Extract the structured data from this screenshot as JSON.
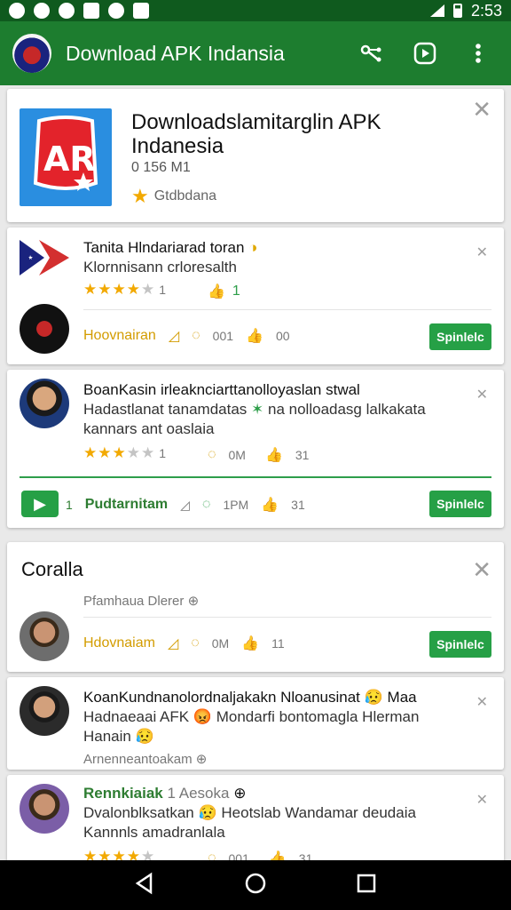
{
  "status_bar": {
    "time": "2:53"
  },
  "app_bar": {
    "title": "Download APK Indansia"
  },
  "apk_card": {
    "title": "Downloadslamitarglin APK Indanesia",
    "meta": "0 156 M1",
    "rating_label": "Gtdbdana"
  },
  "post1": {
    "title": "Tanita Hlndariarad toran",
    "subtitle": "Klornnisann crloresalth",
    "rating_count": "1",
    "like_count": "1",
    "action_label": "Hoovnairan",
    "comment_count": "001",
    "share_count": "00",
    "button": "Spinlelc"
  },
  "post2": {
    "title": "BoanKasin irleaknciarttanolloyaslan stwal",
    "subtitle_line1": "Hadastlanat tanamdatas",
    "subtitle_line1b": "na nolloadasg lalkakata",
    "subtitle_line2": "kannars ant oaslaia",
    "rating_count": "1",
    "comment_count": "0M",
    "share_count": "31",
    "play_count": "1",
    "action_label": "Pudtarnitam",
    "comment2_count": "1PM",
    "share2_count": "31",
    "button": "Spinlelc"
  },
  "post3": {
    "heading": "Coralla",
    "subtitle": "Pfamhaua Dlerer",
    "action_label": "Hdovnaiam",
    "comment_count": "0M",
    "share_count": "11",
    "button": "Spinlelc"
  },
  "post4": {
    "line1": "KoanKundnanolordnaljakakn Nloanusinat",
    "line1b": "Maa",
    "line2": "Hadnaeaai AFK",
    "line2b": "Mondarfi bontomagla Hlerman",
    "line3": "Hanain",
    "meta": "Arnenneantoakam"
  },
  "post5": {
    "name": "Rennkiaiak",
    "name_suffix": "1 Aesoka",
    "line2": "Dvalonblksatkan",
    "line2b": "Heotslab Wandamar deudaia",
    "line3": "Kannnls amadranlala",
    "comment_count": "001",
    "share_count": "31"
  },
  "colors": {
    "app_bar": "#1d7d2f",
    "status_bar": "#0f5a1e",
    "accent": "#26a046",
    "star": "#f2a900"
  }
}
